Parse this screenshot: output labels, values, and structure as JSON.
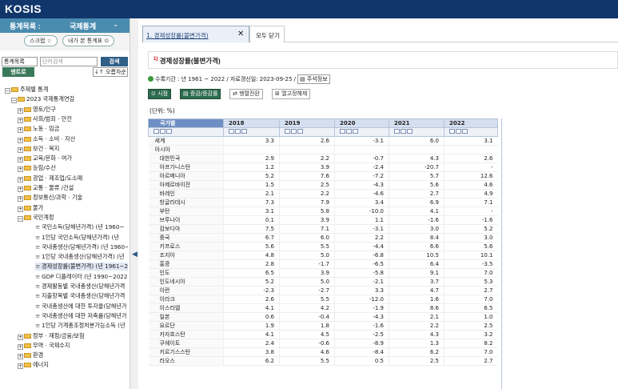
{
  "app": {
    "logo": "KOSIS"
  },
  "sidebar": {
    "header_label": "통계목록 :",
    "header_category": "국제통계",
    "header_chevron": "⌄",
    "pill_scrap": "스크랩 ☆",
    "pill_mystats": "내가 본 통계표 ⊙",
    "search_select": "통계목록",
    "search_placeholder": "단어검색",
    "search_button": "검색",
    "menu_button": "멘트로",
    "sort_button": "↓↑ 오름차순",
    "tree": [
      {
        "label": "주제별 통계",
        "type": "folder",
        "pm": "−",
        "indent": 0
      },
      {
        "label": "2023 국제통계연감",
        "type": "folder",
        "pm": "−",
        "indent": 1
      },
      {
        "label": "영토/인구",
        "type": "folder",
        "pm": "+",
        "indent": 2
      },
      {
        "label": "사회/범죄 · 안전",
        "type": "folder",
        "pm": "+",
        "indent": 2
      },
      {
        "label": "노동 · 임금",
        "type": "folder",
        "pm": "+",
        "indent": 2
      },
      {
        "label": "소득 · 소비 · 자산",
        "type": "folder",
        "pm": "+",
        "indent": 2
      },
      {
        "label": "보건 · 복지",
        "type": "folder",
        "pm": "+",
        "indent": 2
      },
      {
        "label": "교육/문화 · 여가",
        "type": "folder",
        "pm": "+",
        "indent": 2
      },
      {
        "label": "농림/수산",
        "type": "folder",
        "pm": "+",
        "indent": 2
      },
      {
        "label": "광업 · 제조업/도소매",
        "type": "folder",
        "pm": "+",
        "indent": 2
      },
      {
        "label": "교통 · 물류 /건설",
        "type": "folder",
        "pm": "+",
        "indent": 2
      },
      {
        "label": "정보통신/과학 · 기술",
        "type": "folder",
        "pm": "+",
        "indent": 2
      },
      {
        "label": "물가",
        "type": "folder",
        "pm": "+",
        "indent": 2
      },
      {
        "label": "국민계정",
        "type": "folder",
        "pm": "−",
        "indent": 2
      },
      {
        "label": "국민소득(당해년가격) (년 1960~",
        "type": "doc",
        "indent": 3
      },
      {
        "label": "1인당 국민소득(당해년가격) (년",
        "type": "doc",
        "indent": 3
      },
      {
        "label": "국내총생산(당해년가격) (년 1960~",
        "type": "doc",
        "indent": 3
      },
      {
        "label": "1인당 국내총생산(당해년가격) (년",
        "type": "doc",
        "indent": 3
      },
      {
        "label": "경제성장률(불변가격) (년 1961~20",
        "type": "doc",
        "indent": 3,
        "selected": true
      },
      {
        "label": "GDP 디플레이터 (년 1990~2022)",
        "type": "doc",
        "indent": 3
      },
      {
        "label": "경제활동별 국내총생산(당해년가격",
        "type": "doc",
        "indent": 3
      },
      {
        "label": "지출항목별 국내총생산(당해년가격",
        "type": "doc",
        "indent": 3
      },
      {
        "label": "국내총생산에 대한 투자율(당해년가",
        "type": "doc",
        "indent": 3
      },
      {
        "label": "국내총생산에 대한 저축률(당해년가",
        "type": "doc",
        "indent": 3
      },
      {
        "label": "1인당 가계총조정처분가능소득 (년",
        "type": "doc",
        "indent": 3
      },
      {
        "label": "정부 · 재정/금융/보험",
        "type": "folder",
        "pm": "+",
        "indent": 2
      },
      {
        "label": "무역 · 국제수지",
        "type": "folder",
        "pm": "+",
        "indent": 2
      },
      {
        "label": "환경",
        "type": "folder",
        "pm": "+",
        "indent": 2
      },
      {
        "label": "에너지",
        "type": "folder",
        "pm": "+",
        "indent": 2
      }
    ]
  },
  "tabs": {
    "active_label": "1. 경제성장률(불변가격)",
    "close_glyph": "✕",
    "close_all": "모두 닫기"
  },
  "table_title": {
    "marker": "1)",
    "title": "경제성장률(불변가격)"
  },
  "meta": {
    "text": "수록기간 : 년 1961 ~ 2022 / 자료갱신일: 2023-09-25 /",
    "note_button": "▤ 주석정보"
  },
  "toolbar": {
    "timepoint": "⊙ 시점",
    "rate": "▤ 증감/증감률",
    "pivot": "⇄ 행렬전환",
    "fix": "⊞ 열고정해제"
  },
  "unit_label": "(단위: %)",
  "grid": {
    "corner": "국가별",
    "years": [
      "2018",
      "2019",
      "2020",
      "2021",
      "2022"
    ],
    "rows": [
      {
        "name": "세계",
        "sub": false,
        "values": [
          "3.3",
          "2.6",
          "-3.1",
          "6.0",
          "3.1"
        ]
      },
      {
        "name": "아시아",
        "sub": false,
        "values": [
          "",
          "",
          "",
          "",
          ""
        ]
      },
      {
        "name": "대한민국",
        "sub": true,
        "values": [
          "2.9",
          "2.2",
          "-0.7",
          "4.3",
          "2.6"
        ]
      },
      {
        "name": "아프가니스탄",
        "sub": true,
        "values": [
          "1.2",
          "3.9",
          "-2.4",
          "-20.7",
          "-"
        ]
      },
      {
        "name": "아르메니아",
        "sub": true,
        "values": [
          "5.2",
          "7.6",
          "-7.2",
          "5.7",
          "12.6"
        ]
      },
      {
        "name": "아제르바이잔",
        "sub": true,
        "values": [
          "1.5",
          "2.5",
          "-4.3",
          "5.6",
          "4.6"
        ]
      },
      {
        "name": "바레인",
        "sub": true,
        "values": [
          "2.1",
          "2.2",
          "-4.6",
          "2.7",
          "4.9"
        ]
      },
      {
        "name": "방글라데시",
        "sub": true,
        "values": [
          "7.3",
          "7.9",
          "3.4",
          "6.9",
          "7.1"
        ]
      },
      {
        "name": "부탄",
        "sub": true,
        "values": [
          "3.1",
          "5.8",
          "-10.0",
          "4.1",
          "-"
        ]
      },
      {
        "name": "브루나이",
        "sub": true,
        "values": [
          "0.1",
          "3.9",
          "1.1",
          "-1.6",
          "-1.6"
        ]
      },
      {
        "name": "캄보디아",
        "sub": true,
        "values": [
          "7.5",
          "7.1",
          "-3.1",
          "3.0",
          "5.2"
        ]
      },
      {
        "name": "중국",
        "sub": true,
        "values": [
          "6.7",
          "6.0",
          "2.2",
          "8.4",
          "3.0"
        ]
      },
      {
        "name": "키프로스",
        "sub": true,
        "values": [
          "5.6",
          "5.5",
          "-4.4",
          "6.6",
          "5.6"
        ]
      },
      {
        "name": "조지아",
        "sub": true,
        "values": [
          "4.8",
          "5.0",
          "-6.8",
          "10.5",
          "10.1"
        ]
      },
      {
        "name": "홍콩",
        "sub": true,
        "values": [
          "2.8",
          "-1.7",
          "-6.5",
          "6.4",
          "-3.5"
        ]
      },
      {
        "name": "인도",
        "sub": true,
        "values": [
          "6.5",
          "3.9",
          "-5.8",
          "9.1",
          "7.0"
        ]
      },
      {
        "name": "인도네시아",
        "sub": true,
        "values": [
          "5.2",
          "5.0",
          "-2.1",
          "3.7",
          "5.3"
        ]
      },
      {
        "name": "이란",
        "sub": true,
        "values": [
          "-2.3",
          "-2.7",
          "3.3",
          "4.7",
          "2.7"
        ]
      },
      {
        "name": "이라크",
        "sub": true,
        "values": [
          "2.6",
          "5.5",
          "-12.0",
          "1.6",
          "7.0"
        ]
      },
      {
        "name": "이스라엘",
        "sub": true,
        "values": [
          "4.1",
          "4.2",
          "-1.9",
          "8.6",
          "6.5"
        ]
      },
      {
        "name": "일본",
        "sub": true,
        "values": [
          "0.6",
          "-0.4",
          "-4.3",
          "2.1",
          "1.0"
        ]
      },
      {
        "name": "요르단",
        "sub": true,
        "values": [
          "1.9",
          "1.8",
          "-1.6",
          "2.2",
          "2.5"
        ]
      },
      {
        "name": "카자흐스탄",
        "sub": true,
        "values": [
          "4.1",
          "4.5",
          "-2.5",
          "4.3",
          "3.2"
        ]
      },
      {
        "name": "쿠웨이트",
        "sub": true,
        "values": [
          "2.4",
          "-0.6",
          "-8.9",
          "1.3",
          "8.2"
        ]
      },
      {
        "name": "키르기스스탄",
        "sub": true,
        "values": [
          "3.8",
          "4.6",
          "-8.4",
          "6.2",
          "7.0"
        ]
      },
      {
        "name": "라오스",
        "sub": true,
        "values": [
          "6.2",
          "5.5",
          "0.5",
          "2.5",
          "2.7"
        ]
      }
    ]
  }
}
